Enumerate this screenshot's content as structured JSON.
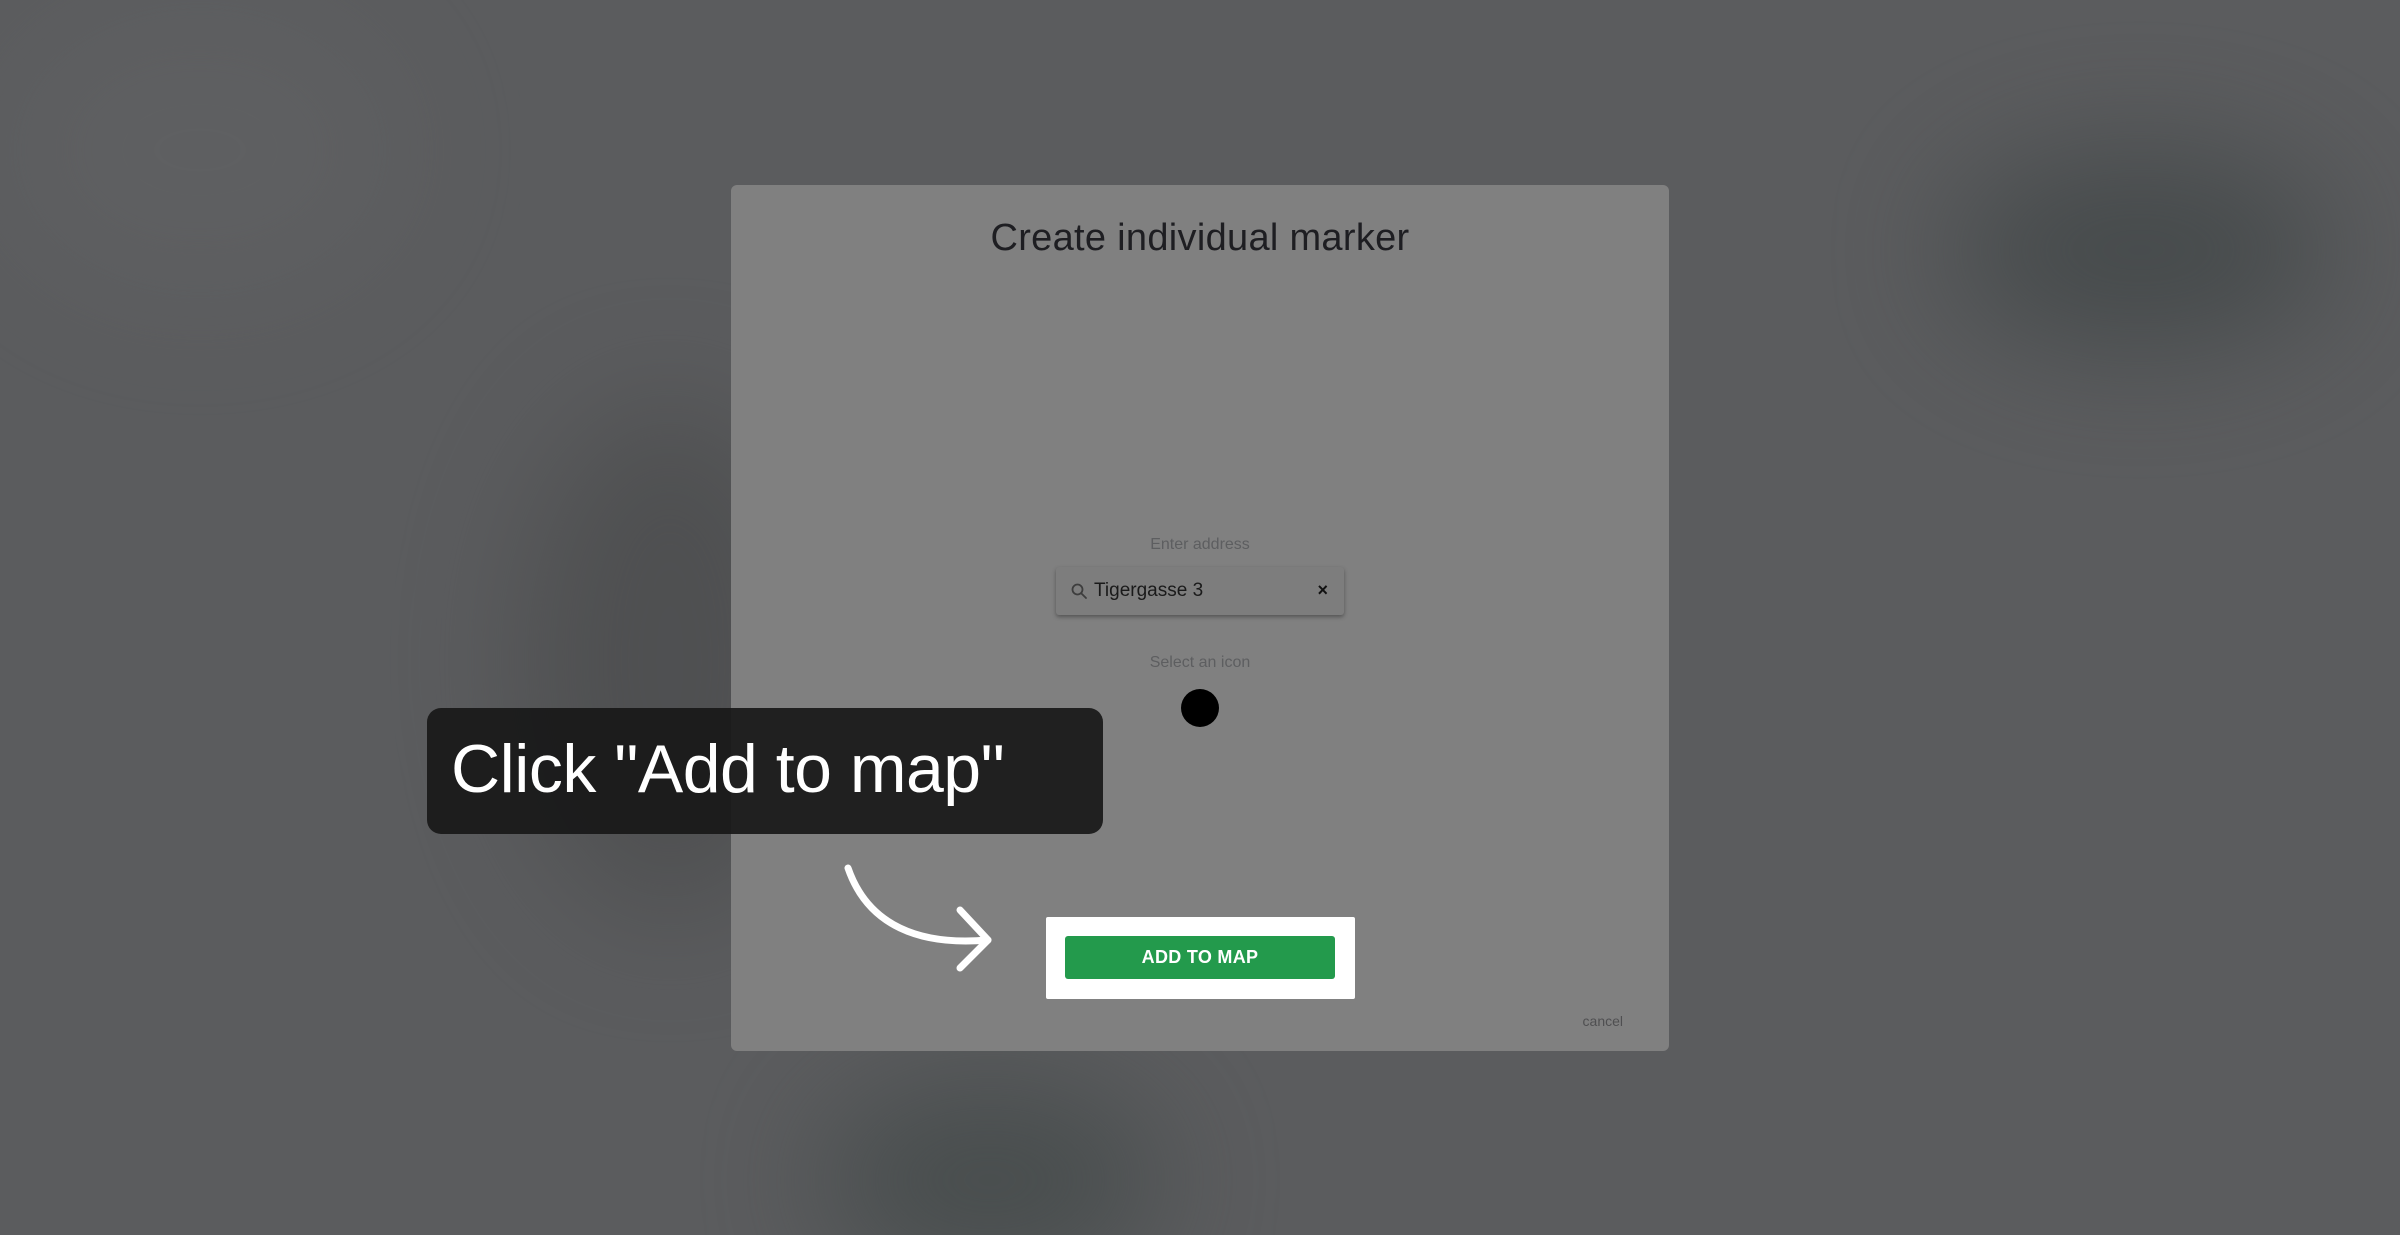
{
  "modal": {
    "title": "Create individual marker",
    "address_label": "Enter address",
    "address_value": "Tigergasse 3",
    "clear_symbol": "×",
    "icon_label": "Select an icon",
    "add_button_label": "ADD TO MAP",
    "cancel_label": "cancel"
  },
  "callout": {
    "text": "Click \"Add to map\""
  },
  "icons": {
    "search": "search-icon",
    "clear": "close-icon",
    "marker": "circle-marker-icon",
    "arrow": "curved-arrow-icon"
  },
  "colors": {
    "primary_button": "#239a4c",
    "overlay": "#5b5c5e",
    "modal": "#808080",
    "callout": "#181818"
  }
}
